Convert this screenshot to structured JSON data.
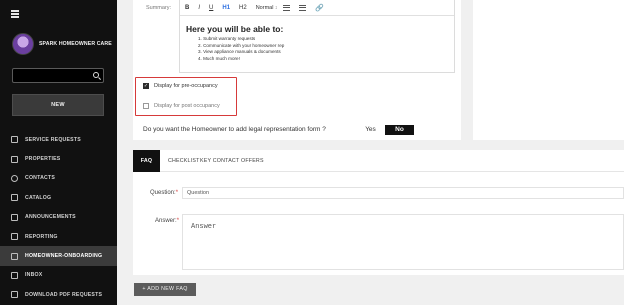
{
  "sidebar": {
    "brand_name": "SPARK HOMEOWNER CARE",
    "search_placeholder": "",
    "new_label": "NEW",
    "items": [
      {
        "label": "SERVICE REQUESTS",
        "icon": "wrench-icon"
      },
      {
        "label": "PROPERTIES",
        "icon": "building-icon"
      },
      {
        "label": "CONTACTS",
        "icon": "contacts-icon"
      },
      {
        "label": "CATALOG",
        "icon": "catalog-icon"
      },
      {
        "label": "ANNOUNCEMENTS",
        "icon": "megaphone-icon"
      },
      {
        "label": "REPORTING",
        "icon": "chart-icon"
      },
      {
        "label": "HOMEOWNER-ONBOARDING",
        "icon": "home-icon",
        "active": true
      },
      {
        "label": "INBOX",
        "icon": "inbox-icon"
      },
      {
        "label": "DOWNLOAD PDF REQUESTS",
        "icon": "download-icon"
      }
    ]
  },
  "summary": {
    "label": "Summary:",
    "toolbar": {
      "bold": "B",
      "italic": "I",
      "underline": "U",
      "h1": "H1",
      "h2": "H2",
      "format": "Normal"
    },
    "heading": "Here you will be able to:",
    "list": [
      "1. Submit warranty requests",
      "2. Communicate with your homeowner rep",
      "3. View appliance manuals & documents",
      "4. Much much more!"
    ]
  },
  "options": {
    "pre_occupancy": {
      "label": "Display for pre-occupancy",
      "checked": true
    },
    "post_occupancy": {
      "label": "Display for post occupancy",
      "checked": false
    }
  },
  "legal": {
    "question": "Do you want the Homeowner to add legal representation form ?",
    "yes": "Yes",
    "no": "No",
    "selected": "No"
  },
  "tabs": [
    "FAQ",
    "CHECKLIST",
    "KEY CONTACT",
    "OFFERS"
  ],
  "faq_form": {
    "question_label": "Question:",
    "question_placeholder": "Question",
    "answer_label": "Answer:",
    "answer_placeholder": "Answer",
    "add_button": "+ ADD NEW FAQ"
  },
  "colors": {
    "sidebar_bg": "#111111",
    "highlight_border": "#d63a3a",
    "active_tab": "#111111"
  }
}
